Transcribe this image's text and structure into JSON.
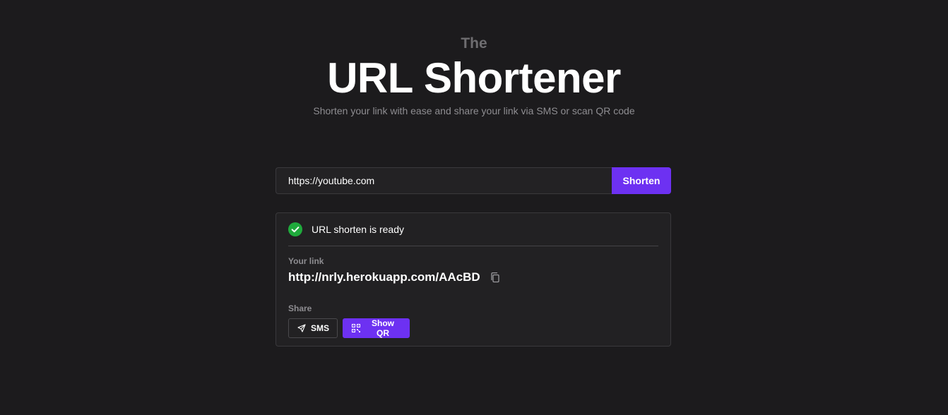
{
  "hero": {
    "pre_title": "The",
    "title": "URL Shortener",
    "subtitle": "Shorten your link with ease and share your link via SMS or scan QR code"
  },
  "form": {
    "url_value": "https://youtube.com",
    "shorten_label": "Shorten"
  },
  "result": {
    "status_icon": "check-circle-icon",
    "status_text": "URL shorten is ready",
    "link_label": "Your link",
    "short_link": "http://nrly.herokuapp.com/AAcBD",
    "copy_icon": "copy-icon",
    "share_label": "Share",
    "sms_label": "SMS",
    "sms_icon": "send-icon",
    "qr_label": "Show QR",
    "qr_icon": "qr-code-icon"
  },
  "colors": {
    "background": "#1c1b1d",
    "accent": "#6d31f2",
    "success": "#1faa3c"
  }
}
